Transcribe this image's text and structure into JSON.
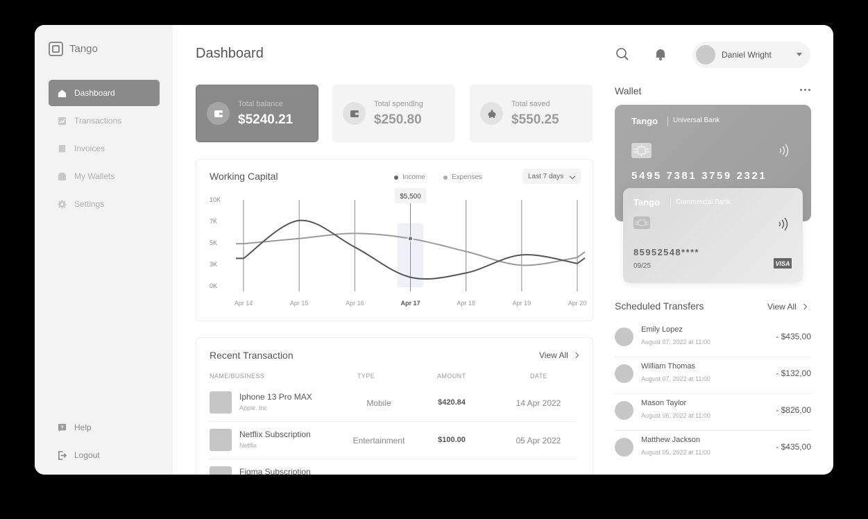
{
  "app": {
    "name": "Tango"
  },
  "sidebar": {
    "items": [
      {
        "label": "Dashboard",
        "icon": "home-icon",
        "active": true
      },
      {
        "label": "Transactions",
        "icon": "chart-icon"
      },
      {
        "label": "Invoices",
        "icon": "invoice-icon"
      },
      {
        "label": "My Wallets",
        "icon": "wallet-icon"
      },
      {
        "label": "Settings",
        "icon": "gear-icon"
      }
    ],
    "bottom": [
      {
        "label": "Help",
        "icon": "help-icon"
      },
      {
        "label": "Logout",
        "icon": "logout-icon"
      }
    ]
  },
  "header": {
    "title": "Dashboard",
    "user": {
      "name": "Daniel Wright"
    }
  },
  "stats": [
    {
      "label": "Total balance",
      "value": "$5240.21"
    },
    {
      "label": "Total spending",
      "value": "$250.80"
    },
    {
      "label": "Total saved",
      "value": "$550.25"
    }
  ],
  "working_capital": {
    "title": "Working Capital",
    "legend": {
      "income": "Income",
      "expenses": "Expenses"
    },
    "range": "Last 7 days",
    "tooltip": "$5,500",
    "highlight_index": 3
  },
  "chart_data": {
    "type": "line",
    "categories": [
      "Apr 14",
      "Apr 15",
      "Apr 16",
      "Apr 17",
      "Apr 18",
      "Apr 19",
      "Apr 20"
    ],
    "y_ticks": [
      "10K",
      "7K",
      "5K",
      "3K",
      "0K"
    ],
    "ylim": [
      0,
      10000
    ],
    "series": [
      {
        "name": "Income",
        "color": "#555555",
        "values": [
          3200,
          7600,
          4500,
          1000,
          1500,
          3600,
          2600
        ]
      },
      {
        "name": "Expenses",
        "color": "#9a9a9a",
        "values": [
          4900,
          5500,
          6100,
          5500,
          4000,
          2400,
          3300
        ]
      }
    ]
  },
  "recent_transactions": {
    "title": "Recent Transaction",
    "view_all": "View All",
    "columns": [
      "NAME/BUSINESS",
      "TYPE",
      "AMOUNT",
      "DATE"
    ],
    "rows": [
      {
        "name": "Iphone 13 Pro MAX",
        "sub": "Apple. Inc",
        "type": "Mobile",
        "amount": "$420.84",
        "date": "14 Apr 2022"
      },
      {
        "name": "Netflix Subscription",
        "sub": "Netflix",
        "type": "Entertainment",
        "amount": "$100.00",
        "date": "05 Apr 2022"
      },
      {
        "name": "Figma Subscription",
        "sub": "",
        "type": "",
        "amount": "",
        "date": ""
      }
    ]
  },
  "wallet": {
    "title": "Wallet",
    "cards": [
      {
        "brand": "Tango",
        "bank": "Universal Bank",
        "number": "5495 7381 3759 2321"
      },
      {
        "brand": "Tango",
        "bank": "Commercial Bank",
        "number": "85952548****",
        "expiry": "09/25",
        "network": "VISA"
      }
    ]
  },
  "scheduled": {
    "title": "Scheduled Transfers",
    "view_all": "View All",
    "rows": [
      {
        "name": "Emily Lopez",
        "date": "August 07, 2022 at 11:00",
        "amount": "- $435,00"
      },
      {
        "name": "William Thomas",
        "date": "August 07, 2022 at 11:00",
        "amount": "- $132,00"
      },
      {
        "name": "Mason Taylor",
        "date": "August 06, 2022 at 11:00",
        "amount": "- $826,00"
      },
      {
        "name": "Matthew Jackson",
        "date": "August 05, 2022 at 11:00",
        "amount": "- $435,00"
      }
    ]
  }
}
